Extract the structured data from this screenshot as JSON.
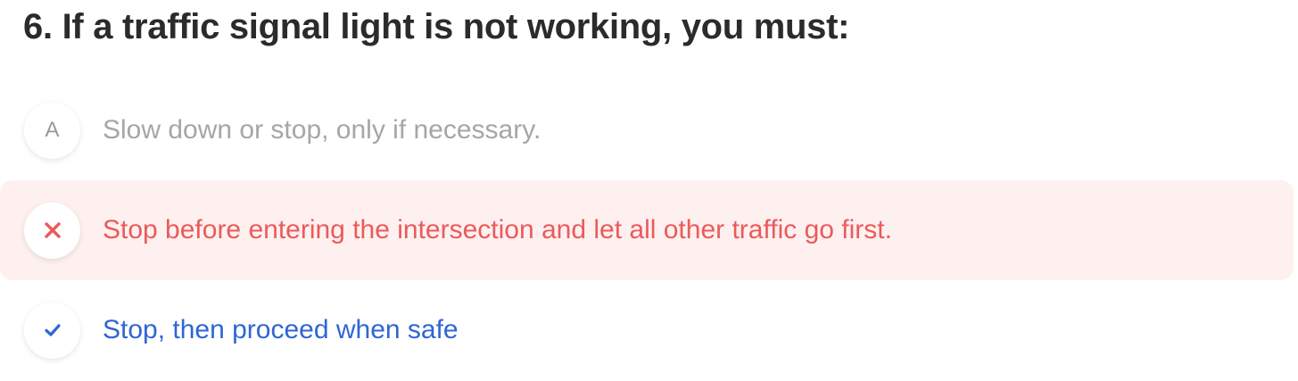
{
  "question": {
    "title": "6. If a traffic signal light is not working, you must:"
  },
  "options": [
    {
      "marker": "A",
      "marker_icon": null,
      "text": "Slow down or stop, only if necessary.",
      "state": "neutral"
    },
    {
      "marker": null,
      "marker_icon": "close-icon",
      "text": "Stop before entering the intersection and let all other traffic go first.",
      "state": "incorrect"
    },
    {
      "marker": null,
      "marker_icon": "check-icon",
      "text": "Stop, then proceed when safe",
      "state": "correct"
    }
  ],
  "colors": {
    "title": "#2b2b2b",
    "neutral_text": "#a6a6a6",
    "incorrect_text": "#ec5a5a",
    "incorrect_background": "#fff0f0",
    "correct_text": "#2f66d4"
  }
}
